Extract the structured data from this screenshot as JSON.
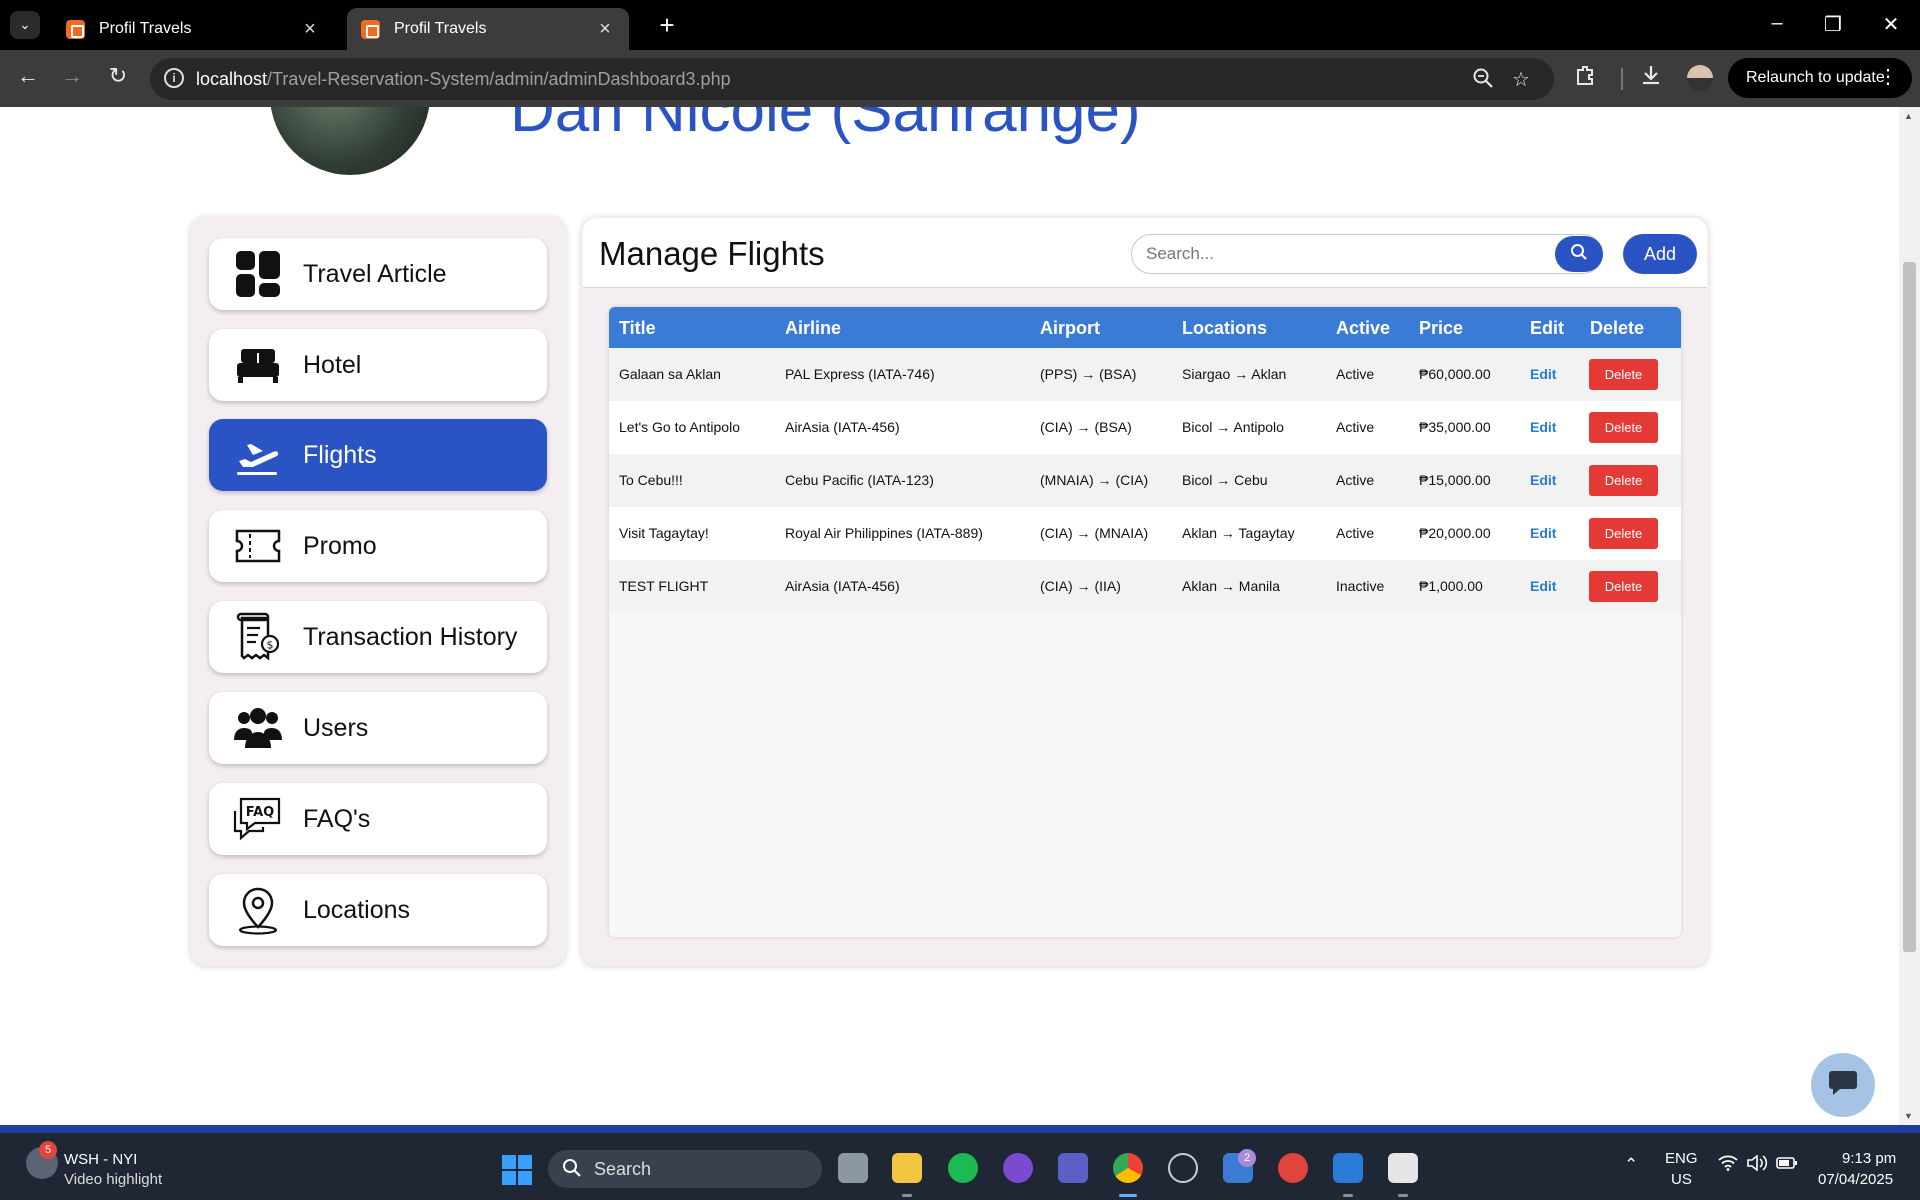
{
  "browser": {
    "tabs": [
      {
        "title": "Profil Travels",
        "active": false
      },
      {
        "title": "Profil Travels",
        "active": true
      }
    ],
    "url_host": "localhost",
    "url_path": "/Travel-Reservation-System/admin/adminDashboard3.php",
    "relaunch_label": "Relaunch to update"
  },
  "header": {
    "user_name": "Dan Nicole (Sanrange)"
  },
  "sidebar": {
    "items": [
      {
        "label": "Travel Article",
        "icon": "dashboard-icon",
        "active": false
      },
      {
        "label": "Hotel",
        "icon": "bed-icon",
        "active": false
      },
      {
        "label": "Flights",
        "icon": "plane-departure-icon",
        "active": true
      },
      {
        "label": "Promo",
        "icon": "ticket-icon",
        "active": false
      },
      {
        "label": "Transaction History",
        "icon": "receipt-icon",
        "active": false
      },
      {
        "label": "Users",
        "icon": "users-icon",
        "active": false
      },
      {
        "label": "FAQ's",
        "icon": "faq-icon",
        "active": false
      },
      {
        "label": "Locations",
        "icon": "map-pin-icon",
        "active": false
      }
    ]
  },
  "main": {
    "title": "Manage Flights",
    "search_placeholder": "Search...",
    "add_label": "Add",
    "table": {
      "columns": [
        "Title",
        "Airline",
        "Airport",
        "Locations",
        "Active",
        "Price",
        "Edit",
        "Delete"
      ],
      "rows": [
        {
          "title": "Galaan sa Aklan",
          "airline": "PAL Express (IATA-746)",
          "airport": "(PPS) → (BSA)",
          "locations": "Siargao → Aklan",
          "active": "Active",
          "price": "₱60,000.00",
          "edit": "Edit",
          "delete": "Delete"
        },
        {
          "title": "Let's Go to Antipolo",
          "airline": "AirAsia (IATA-456)",
          "airport": "(CIA) → (BSA)",
          "locations": "Bicol → Antipolo",
          "active": "Active",
          "price": "₱35,000.00",
          "edit": "Edit",
          "delete": "Delete"
        },
        {
          "title": "To Cebu!!!",
          "airline": "Cebu Pacific (IATA-123)",
          "airport": "(MNAIA) → (CIA)",
          "locations": "Bicol → Cebu",
          "active": "Active",
          "price": "₱15,000.00",
          "edit": "Edit",
          "delete": "Delete"
        },
        {
          "title": "Visit Tagaytay!",
          "airline": "Royal Air Philippines (IATA-889)",
          "airport": "(CIA) → (MNAIA)",
          "locations": "Aklan → Tagaytay",
          "active": "Active",
          "price": "₱20,000.00",
          "edit": "Edit",
          "delete": "Delete"
        },
        {
          "title": "TEST FLIGHT",
          "airline": "AirAsia (IATA-456)",
          "airport": "(CIA) → (IIA)",
          "locations": "Aklan → Manila",
          "active": "Inactive",
          "price": "₱1,000.00",
          "edit": "Edit",
          "delete": "Delete"
        }
      ]
    }
  },
  "taskbar": {
    "notification_count": "5",
    "weather_title": "WSH - NYI",
    "weather_subtitle": "Video highlight",
    "search_label": "Search",
    "todo_badge": "2",
    "lang_top": "ENG",
    "lang_bottom": "US",
    "time": "9:13 pm",
    "date": "07/04/2025"
  },
  "colors": {
    "primary": "#2a54c4",
    "table_header": "#3a7bd5",
    "danger": "#e53935",
    "panel_bg": "#f4eef2"
  }
}
